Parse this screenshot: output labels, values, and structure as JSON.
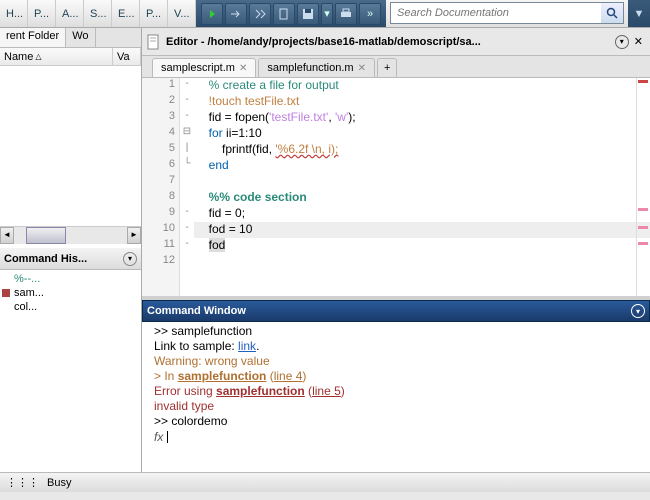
{
  "menubar": [
    "H...",
    "P...",
    "A...",
    "S...",
    "E...",
    "P...",
    "V..."
  ],
  "search": {
    "placeholder": "Search Documentation"
  },
  "left": {
    "folder_hdr": "rent Folder",
    "folder_tab2": "Wo",
    "col_name": "Name",
    "col_val": "Va",
    "cmdhist_hdr": "Command His...",
    "hist": [
      "%--...",
      "sam...",
      "col..."
    ]
  },
  "editor": {
    "title": "Editor - /home/andy/projects/base16-matlab/demoscript/sa...",
    "tabs": [
      "samplescript.m",
      "samplefunction.m"
    ],
    "gutter": [
      "1",
      "2",
      "3",
      "4",
      "5",
      "6",
      "7",
      "8",
      "9",
      "10",
      "11",
      "12"
    ],
    "fold": [
      "-",
      "-",
      "-",
      "⊟",
      "|",
      "└",
      "",
      "",
      "-",
      "-",
      "-",
      ""
    ],
    "lines": {
      "l1_cmt": "% create a file for output",
      "l2_sys": "!touch testFile.txt",
      "l3a": "fid = fopen(",
      "l3s": "'testFile.txt'",
      "l3b": ", ",
      "l3s2": "'w'",
      "l3c": ");",
      "l4k": "for",
      "l4b": " ii=1:10",
      "l5a": "    fprintf(fid, ",
      "l5e": "'%6.2f \\n, i);",
      "l6k": "end",
      "l8": "%% code section",
      "l9": "fid = 0;",
      "l10": "fod = 10",
      "l11": "fod"
    }
  },
  "cmd": {
    "title": "Command Window",
    "l1": ">> samplefunction",
    "l2a": "Link to sample: ",
    "l2b": "link",
    "l2c": ".",
    "l3": "Warning: wrong value",
    "l4a": "> In ",
    "l4b": "samplefunction",
    "l4c": " (",
    "l4d": "line 4",
    "l4e": ")",
    "l5a": "Error using ",
    "l5b": "samplefunction",
    "l5c": " (",
    "l5d": "line 5",
    "l5e": ")",
    "l6": "invalid type",
    "l7": ">> colordemo",
    "fx": "fx"
  },
  "status": "Busy"
}
